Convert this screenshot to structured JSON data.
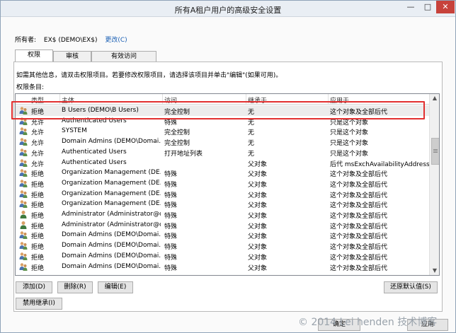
{
  "window": {
    "title": "所有A租户用户的高级安全设置",
    "minimize": "—",
    "maximize": "□",
    "close": "✕"
  },
  "owner": {
    "label": "所有者:",
    "value": "EX$ (DEMO\\EX$)",
    "change_link": "更改(C)"
  },
  "tabs": [
    "权限",
    "审核",
    "有效访问"
  ],
  "panel": {
    "info": "如需其他信息，请双击权限项目。若要修改权限项目，请选择该项目并单击\"编辑\"(如果可用)。",
    "list_label": "权限条目:"
  },
  "table": {
    "columns": [
      "类型",
      "主体",
      "访问",
      "继承于",
      "应用于"
    ],
    "rows": [
      {
        "icon": "group-icon",
        "type": "拒绝",
        "principal": "B Users (DEMO\\B Users)",
        "access": "完全控制",
        "inherited": "无",
        "applies": "这个对象及全部后代"
      },
      {
        "icon": "group-icon",
        "type": "允许",
        "principal": "Authenticated Users",
        "access": "特殊",
        "inherited": "无",
        "applies": "只是这个对象"
      },
      {
        "icon": "group-icon",
        "type": "允许",
        "principal": "SYSTEM",
        "access": "完全控制",
        "inherited": "无",
        "applies": "只是这个对象"
      },
      {
        "icon": "group-icon",
        "type": "允许",
        "principal": "Domain Admins (DEMO\\Domai...",
        "access": "完全控制",
        "inherited": "无",
        "applies": "只是这个对象"
      },
      {
        "icon": "group-icon",
        "type": "允许",
        "principal": "Authenticated Users",
        "access": "打开地址列表",
        "inherited": "无",
        "applies": "只是这个对象"
      },
      {
        "icon": "group-icon",
        "type": "允许",
        "principal": "Authenticated Users",
        "access": "",
        "inherited": "父对象",
        "applies": "后代 msExchAvailabilityAddressS..."
      },
      {
        "icon": "group-icon",
        "type": "拒绝",
        "principal": "Organization Management (DE...",
        "access": "特殊",
        "inherited": "父对象",
        "applies": "这个对象及全部后代"
      },
      {
        "icon": "group-icon",
        "type": "拒绝",
        "principal": "Organization Management (DE...",
        "access": "特殊",
        "inherited": "父对象",
        "applies": "这个对象及全部后代"
      },
      {
        "icon": "group-icon",
        "type": "拒绝",
        "principal": "Organization Management (DE...",
        "access": "特殊",
        "inherited": "父对象",
        "applies": "这个对象及全部后代"
      },
      {
        "icon": "group-icon",
        "type": "拒绝",
        "principal": "Organization Management (DE...",
        "access": "特殊",
        "inherited": "父对象",
        "applies": "这个对象及全部后代"
      },
      {
        "icon": "user-icon",
        "type": "拒绝",
        "principal": "Administrator (Administrator@d...",
        "access": "特殊",
        "inherited": "父对象",
        "applies": "这个对象及全部后代"
      },
      {
        "icon": "user-icon",
        "type": "拒绝",
        "principal": "Administrator (Administrator@d...",
        "access": "特殊",
        "inherited": "父对象",
        "applies": "这个对象及全部后代"
      },
      {
        "icon": "group-icon",
        "type": "拒绝",
        "principal": "Domain Admins (DEMO\\Domai...",
        "access": "特殊",
        "inherited": "父对象",
        "applies": "这个对象及全部后代"
      },
      {
        "icon": "group-icon",
        "type": "拒绝",
        "principal": "Domain Admins (DEMO\\Domai...",
        "access": "特殊",
        "inherited": "父对象",
        "applies": "这个对象及全部后代"
      },
      {
        "icon": "group-icon",
        "type": "拒绝",
        "principal": "Domain Admins (DEMO\\Domai...",
        "access": "特殊",
        "inherited": "父对象",
        "applies": "这个对象及全部后代"
      },
      {
        "icon": "group-icon",
        "type": "拒绝",
        "principal": "Domain Admins (DEMO\\Domai...",
        "access": "特殊",
        "inherited": "父对象",
        "applies": "这个对象及全部后代"
      }
    ]
  },
  "buttons": {
    "add": "添加(D)",
    "remove": "删除(R)",
    "edit": "编辑(E)",
    "restore": "还原默认值(S)",
    "disable_inherit": "禁用继承(I)",
    "ok": "确定",
    "apply": "应用"
  },
  "watermark": "© 2014 Lei henden 技术博客",
  "colors": {
    "highlight": "#e23030",
    "link": "#1a5fb4"
  }
}
